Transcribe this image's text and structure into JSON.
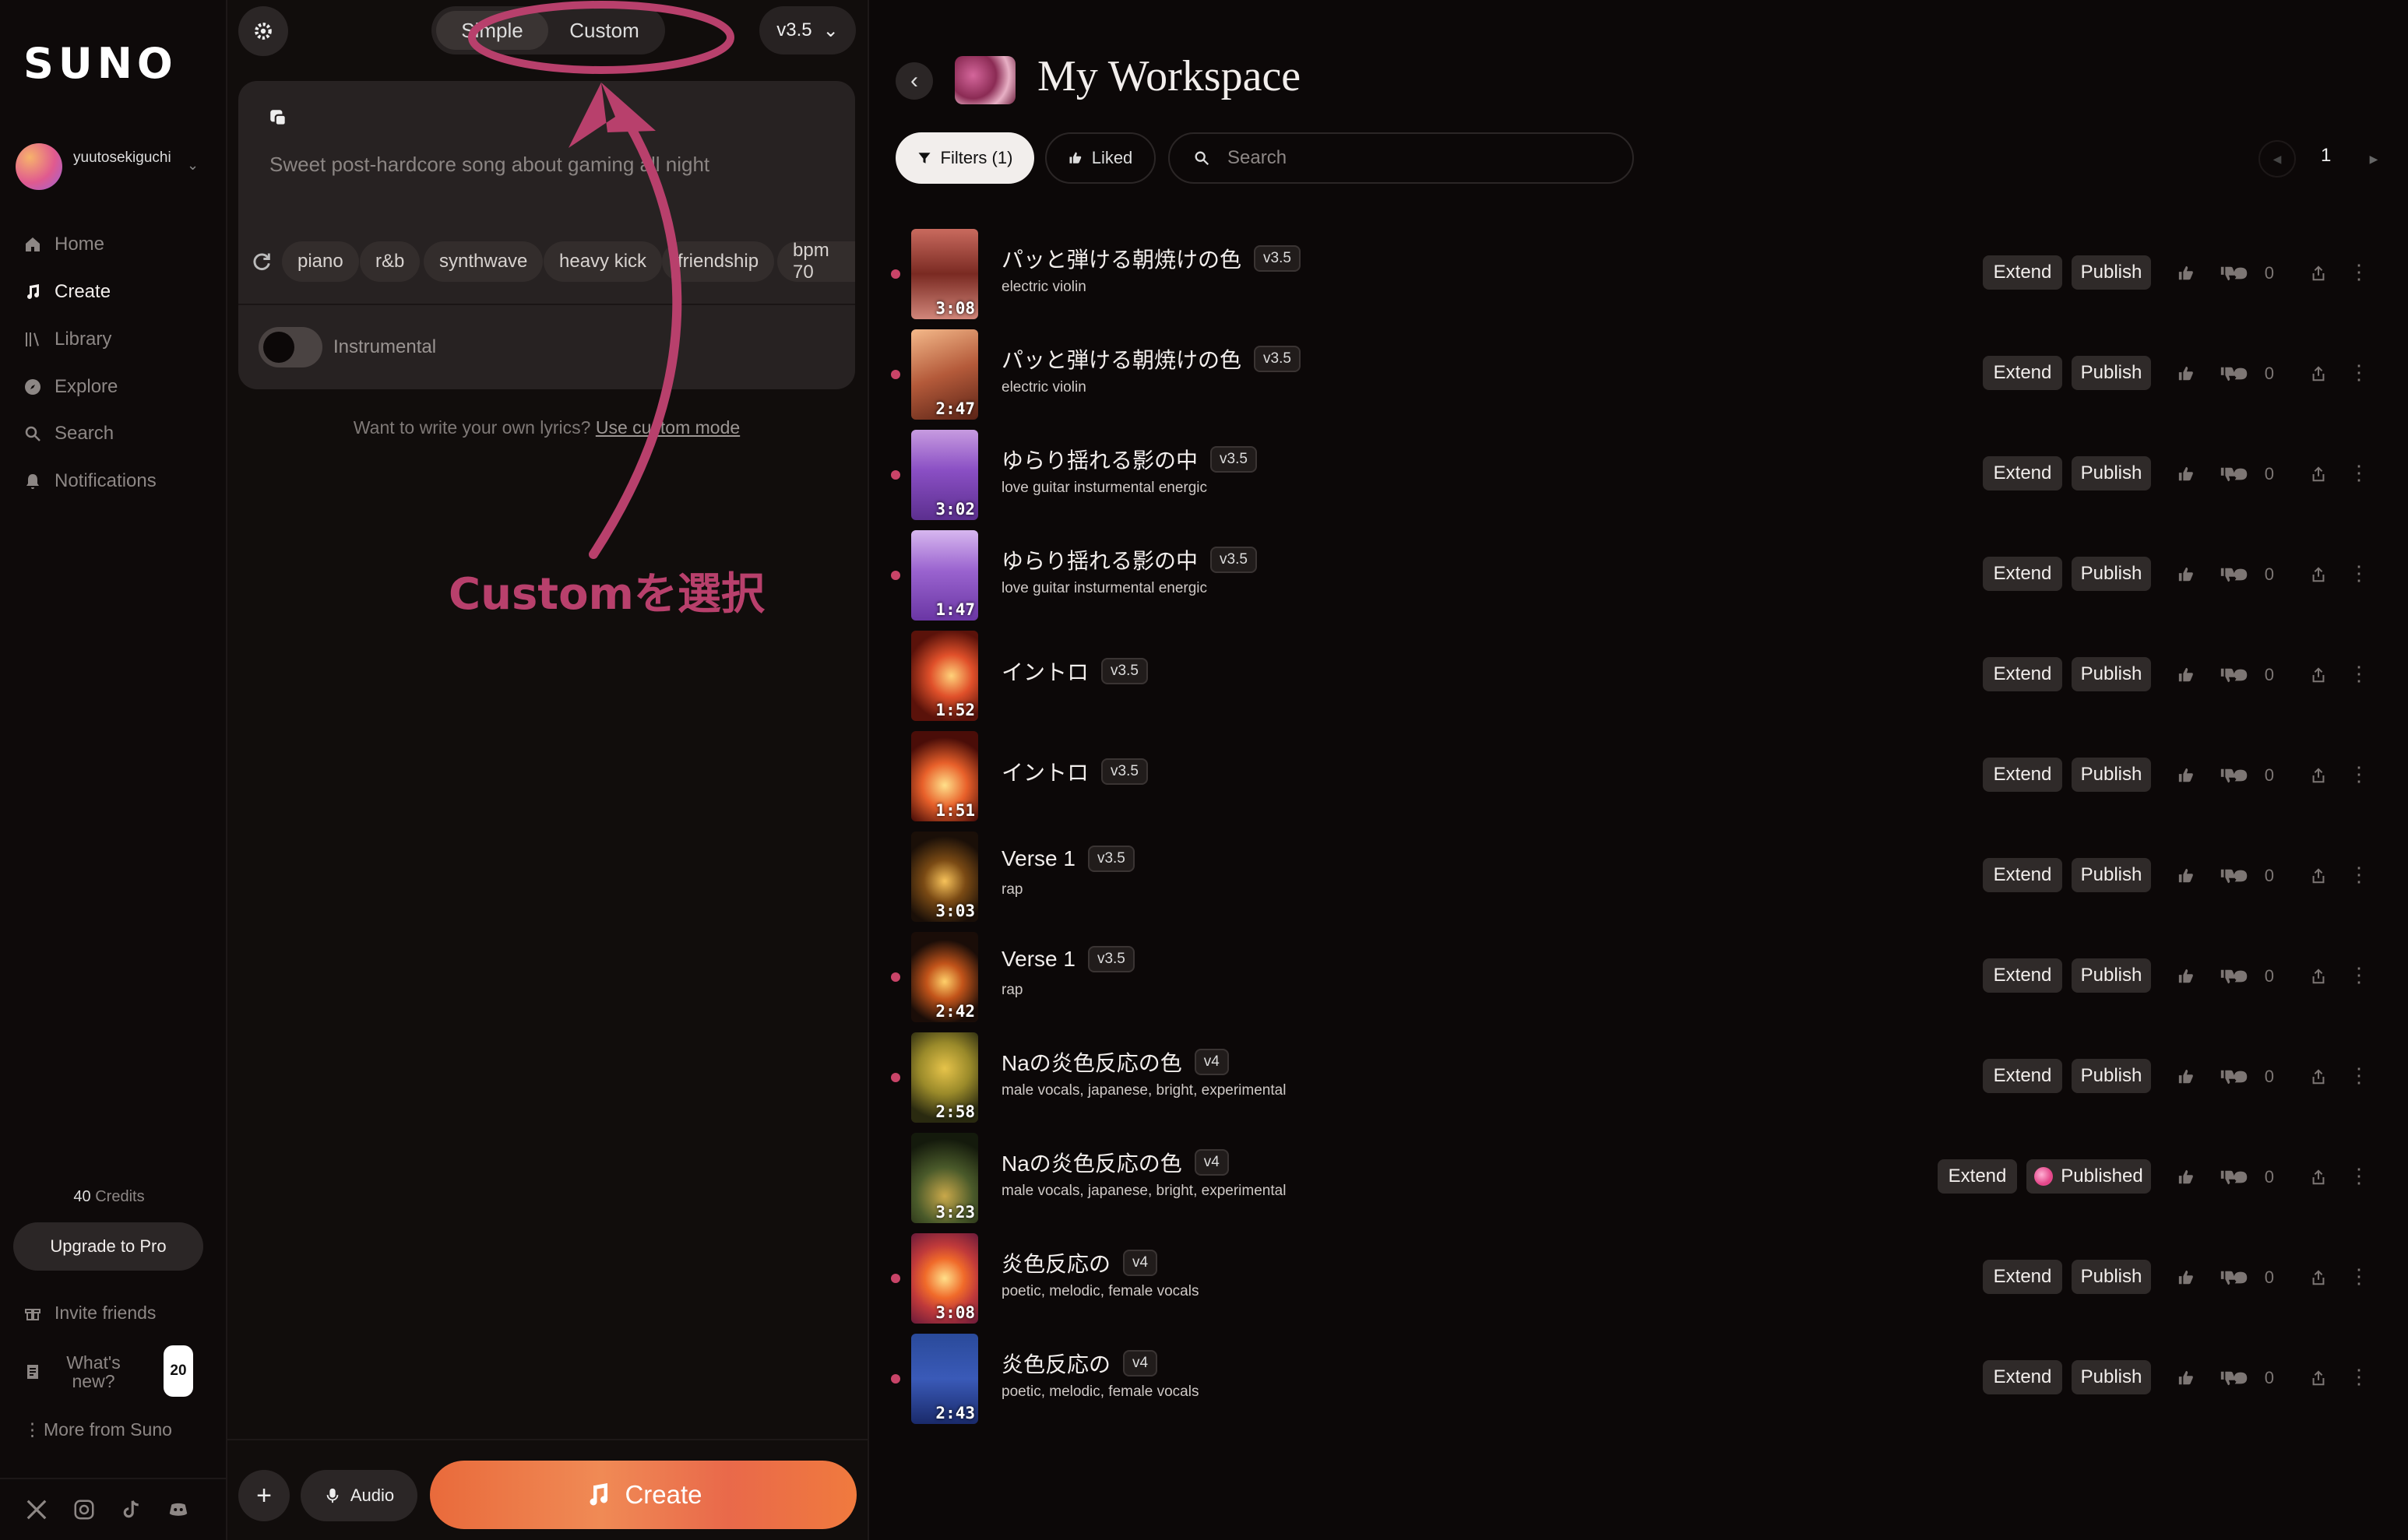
{
  "app": {
    "logo": "SUNO"
  },
  "user": {
    "name": "yuutosekiguchi"
  },
  "nav": [
    {
      "label": "Home",
      "icon": "home-icon",
      "active": false
    },
    {
      "label": "Create",
      "icon": "music-note-icon",
      "active": true
    },
    {
      "label": "Library",
      "icon": "library-icon",
      "active": false
    },
    {
      "label": "Explore",
      "icon": "compass-icon",
      "active": false
    },
    {
      "label": "Search",
      "icon": "search-icon",
      "active": false
    },
    {
      "label": "Notifications",
      "icon": "bell-icon",
      "active": false
    }
  ],
  "credits": {
    "count": "40",
    "label": "Credits"
  },
  "upgrade_label": "Upgrade to Pro",
  "bottom_nav": {
    "invite": "Invite friends",
    "whats_new": "What's new?",
    "whats_new_badge": "20",
    "more": "More from Suno"
  },
  "create_panel": {
    "mode_simple": "Simple",
    "mode_custom": "Custom",
    "version": "v3.5",
    "prompt_placeholder": "Sweet post-hardcore song about gaming all night",
    "chips": [
      "piano",
      "r&b",
      "synthwave",
      "heavy kick",
      "friendship",
      "bpm 70"
    ],
    "instrumental_label": "Instrumental",
    "lyrics_hint": "Want to write your own lyrics?",
    "lyrics_link": "Use custom mode",
    "audio_label": "Audio",
    "create_label": "Create"
  },
  "annotation": {
    "text": "Customを選択",
    "color": "#b8406c"
  },
  "workspace": {
    "title": "My Workspace",
    "filters_label": "Filters (1)",
    "liked_label": "Liked",
    "search_placeholder": "Search",
    "page": "1",
    "extend_label": "Extend",
    "publish_label": "Publish",
    "published_label": "Published",
    "tracks": [
      {
        "title": "パッと弾ける朝焼けの色",
        "version": "v3.5",
        "tags": "electric violin",
        "duration": "3:08",
        "comments": "0",
        "new": true,
        "published": false,
        "thumb": "linear-gradient(180deg,#c96a5e,#7a2a22 50%,#d1867a)"
      },
      {
        "title": "パッと弾ける朝焼けの色",
        "version": "v3.5",
        "tags": "electric violin",
        "duration": "2:47",
        "comments": "0",
        "new": true,
        "published": false,
        "thumb": "linear-gradient(160deg,#f4b98a,#b45a3a 50%,#5a2316)"
      },
      {
        "title": "ゆらり揺れる影の中",
        "version": "v3.5",
        "tags": "love guitar insturmental energic",
        "duration": "3:02",
        "comments": "0",
        "new": true,
        "published": false,
        "thumb": "linear-gradient(180deg,#c79be0,#8a4fc4 45%,#5c2f8f)"
      },
      {
        "title": "ゆらり揺れる影の中",
        "version": "v3.5",
        "tags": "love guitar insturmental energic",
        "duration": "1:47",
        "comments": "0",
        "new": true,
        "published": false,
        "thumb": "linear-gradient(180deg,#d7b7ef,#9a63cf 45%,#6a36a4)"
      },
      {
        "title": "イントロ",
        "version": "v3.5",
        "tags": "",
        "duration": "1:52",
        "comments": "0",
        "new": false,
        "published": false,
        "thumb": "radial-gradient(circle at 60% 50%,#ffd27a,#e0502a 35%,#5a120a 75%)"
      },
      {
        "title": "イントロ",
        "version": "v3.5",
        "tags": "",
        "duration": "1:51",
        "comments": "0",
        "new": false,
        "published": false,
        "thumb": "radial-gradient(circle at 50% 60%,#ffe08a,#e8602a 35%,#4a0d08 75%)"
      },
      {
        "title": "Verse 1",
        "version": "v3.5",
        "tags": "rap",
        "duration": "3:03",
        "comments": "0",
        "new": false,
        "published": false,
        "thumb": "radial-gradient(circle at 50% 55%,#f7c25a,#7a4a14 35%,#1a0f08 75%)"
      },
      {
        "title": "Verse 1",
        "version": "v3.5",
        "tags": "rap",
        "duration": "2:42",
        "comments": "0",
        "new": true,
        "published": false,
        "thumb": "radial-gradient(circle at 50% 55%,#ffd06a,#c2541a 30%,#1a0d08 70%)"
      },
      {
        "title": "Naの炎色反応の色",
        "version": "v4",
        "tags": "male vocals, japanese, bright, experimental",
        "duration": "2:58",
        "comments": "0",
        "new": true,
        "published": false,
        "thumb": "radial-gradient(circle at 50% 40%,#e6c34a,#9a8a2a 40%,#2a2a10 80%)"
      },
      {
        "title": "Naの炎色反応の色",
        "version": "v4",
        "tags": "male vocals, japanese, bright, experimental",
        "duration": "3:23",
        "comments": "0",
        "new": false,
        "published": true,
        "thumb": "radial-gradient(circle at 50% 70%,#c9a84a,#4a5a2a 40%,#141a0c 80%)"
      },
      {
        "title": "炎色反応の",
        "version": "v4",
        "tags": "poetic, melodic, female vocals",
        "duration": "3:08",
        "comments": "0",
        "new": true,
        "published": false,
        "thumb": "radial-gradient(circle at 50% 50%,#ffe08a,#f06a2a 35%,#c03a3a 60%,#6a1a3a)"
      },
      {
        "title": "炎色反応の",
        "version": "v4",
        "tags": "poetic, melodic, female vocals",
        "duration": "2:43",
        "comments": "0",
        "new": true,
        "published": false,
        "thumb": "linear-gradient(180deg,#2a4a9a,#3a5ab8 50%,#1a2a6a)"
      }
    ]
  }
}
